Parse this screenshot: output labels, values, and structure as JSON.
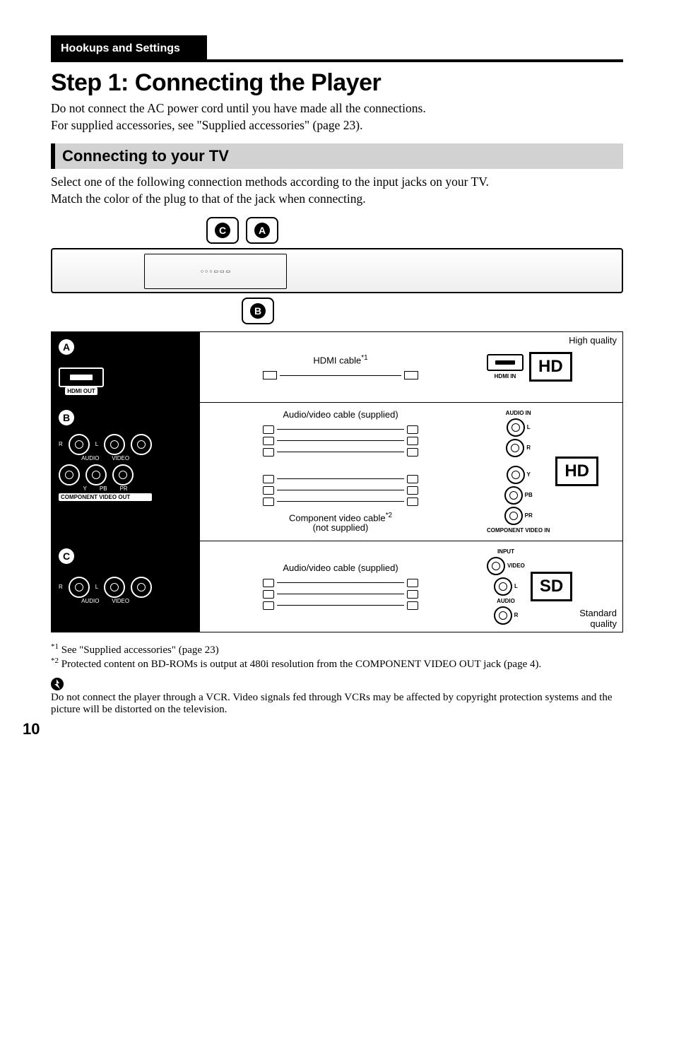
{
  "header": {
    "tab": "Hookups and Settings"
  },
  "title": "Step 1: Connecting the Player",
  "intro_line1": "Do not connect the AC power cord until you have made all the connections.",
  "intro_line2": "For supplied accessories, see \"Supplied accessories\" (page 23).",
  "subsection": "Connecting to your TV",
  "sub_intro_line1": "Select one of the following connection methods according to the input jacks on your TV.",
  "sub_intro_line2": "Match the color of the plug to that of the jack when connecting.",
  "bubbles": {
    "a": "A",
    "b": "B",
    "c": "C"
  },
  "cables": {
    "hdmi": "HDMI cable",
    "hdmi_sup": "*1",
    "av_supplied": "Audio/video cable (supplied)",
    "component": "Component video cable",
    "component_sup": "*2",
    "not_supplied": "(not supplied)"
  },
  "inputs": {
    "hdmi_in": "HDMI IN",
    "audio_in": "AUDIO IN",
    "l": "L",
    "r": "R",
    "y": "Y",
    "pb": "PB",
    "pr": "PR",
    "component_video_in": "COMPONENT VIDEO IN",
    "input": "INPUT",
    "video": "VIDEO",
    "audio": "AUDIO"
  },
  "outputs": {
    "hdmi_out": "HDMI OUT",
    "audio": "AUDIO",
    "video": "VIDEO",
    "component_video_out": "COMPONENT VIDEO OUT",
    "r": "R",
    "l": "L",
    "y": "Y",
    "pb": "PB",
    "pr": "PR"
  },
  "quality": {
    "high": "High quality",
    "hd": "HD",
    "sd": "SD",
    "standard_l1": "Standard",
    "standard_l2": "quality"
  },
  "footnotes": {
    "f1_sup": "*1",
    "f1": " See \"Supplied accessories\" (page 23)",
    "f2_sup": "*2",
    "f2": " Protected content on BD-ROMs is output at 480i resolution from the COMPONENT VIDEO OUT jack (page 4)."
  },
  "note_icon": "⁠𝝗",
  "note_text": "Do not connect the player through a VCR. Video signals fed through VCRs may be affected by copyright protection systems and the picture will be distorted on the television.",
  "page_number": "10"
}
